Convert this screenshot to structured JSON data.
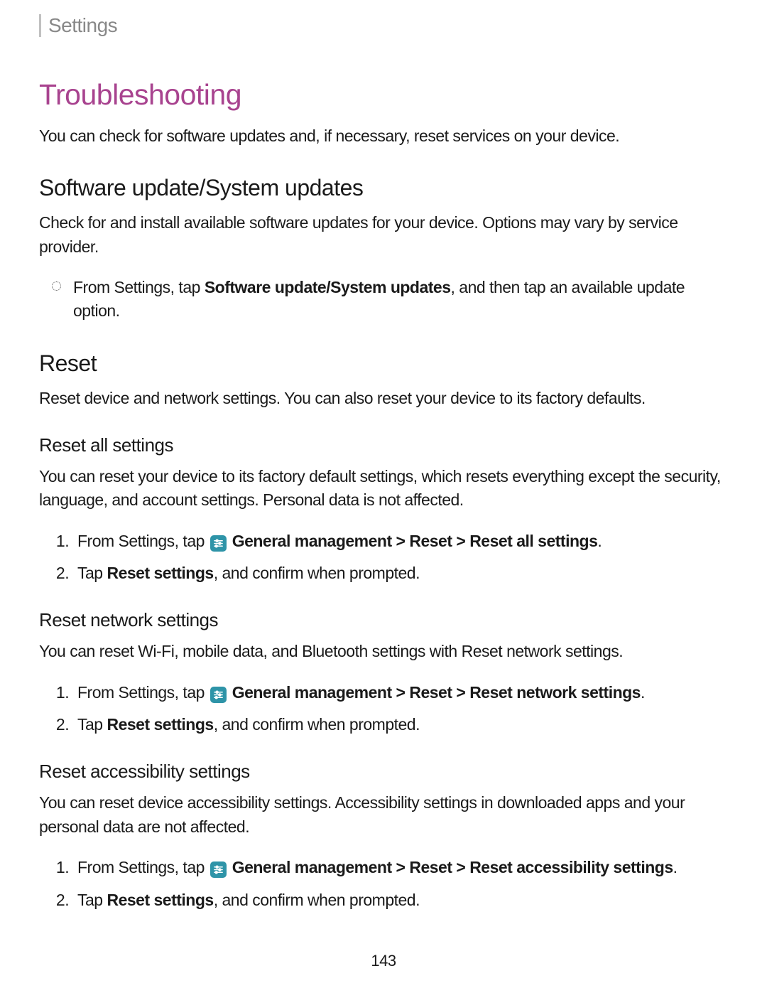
{
  "header": "Settings",
  "title": "Troubleshooting",
  "intro": "You can check for software updates and, if necessary, reset services on your device.",
  "software": {
    "heading": "Software update/System updates",
    "desc": "Check for and install available software updates for your device. Options may vary by service provider.",
    "bullet_prefix": "From Settings, tap ",
    "bullet_bold": "Software update/System updates",
    "bullet_suffix": ", and then tap an available update option."
  },
  "reset": {
    "heading": "Reset",
    "desc": "Reset device and network settings. You can also reset your device to its factory defaults."
  },
  "reset_all": {
    "heading": "Reset all settings",
    "desc": "You can reset your device to its factory default settings, which resets everything except the security, language, and account settings. Personal data is not affected.",
    "step1_prefix": "From Settings, tap ",
    "step1_bold": " General management > Reset > Reset all settings",
    "step1_suffix": ".",
    "step2_prefix": "Tap ",
    "step2_bold": "Reset settings",
    "step2_suffix": ", and confirm when prompted."
  },
  "reset_network": {
    "heading": "Reset network settings",
    "desc": "You can reset Wi-Fi, mobile data, and Bluetooth settings with Reset network settings.",
    "step1_prefix": "From Settings, tap ",
    "step1_bold": " General management > Reset > Reset network settings",
    "step1_suffix": ".",
    "step2_prefix": "Tap ",
    "step2_bold": "Reset settings",
    "step2_suffix": ", and confirm when prompted."
  },
  "reset_accessibility": {
    "heading": "Reset accessibility settings",
    "desc": "You can reset device accessibility settings. Accessibility settings in downloaded apps and your personal data are not affected.",
    "step1_prefix": "From Settings, tap ",
    "step1_bold": " General management > Reset > Reset accessibility settings",
    "step1_suffix": ".",
    "step2_prefix": "Tap ",
    "step2_bold": "Reset settings",
    "step2_suffix": ", and confirm when prompted."
  },
  "page_number": "143"
}
